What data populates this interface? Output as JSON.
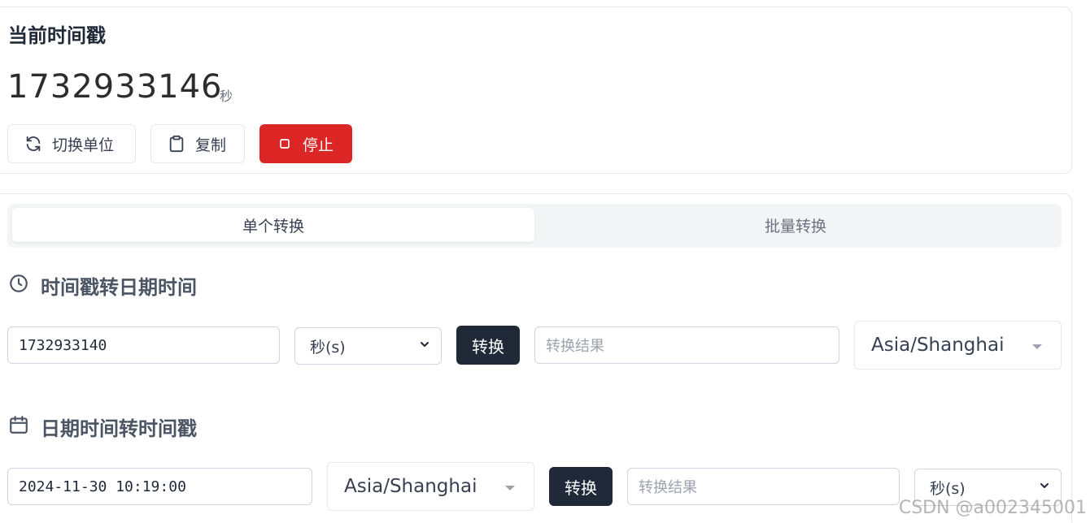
{
  "current": {
    "title": "当前时间戳",
    "timestamp": "1732933146",
    "unit": "秒",
    "buttons": {
      "switch_unit": "切换单位",
      "copy": "复制",
      "stop": "停止"
    }
  },
  "tabs": [
    {
      "label": "单个转换",
      "active": true
    },
    {
      "label": "批量转换",
      "active": false
    }
  ],
  "ts_to_date": {
    "title": "时间戳转日期时间",
    "input_value": "1732933140",
    "unit_select": "秒(s)",
    "convert_label": "转换",
    "result_placeholder": "转换结果",
    "timezone": "Asia/Shanghai"
  },
  "date_to_ts": {
    "title": "日期时间转时间戳",
    "input_value": "2024-11-30 10:19:00",
    "timezone": "Asia/Shanghai",
    "convert_label": "转换",
    "result_placeholder": "转换结果",
    "unit_select": "秒(s)"
  },
  "watermark": "CSDN @a002345001",
  "colors": {
    "stop_button": "#dc2626",
    "convert_button": "#1f2937"
  }
}
